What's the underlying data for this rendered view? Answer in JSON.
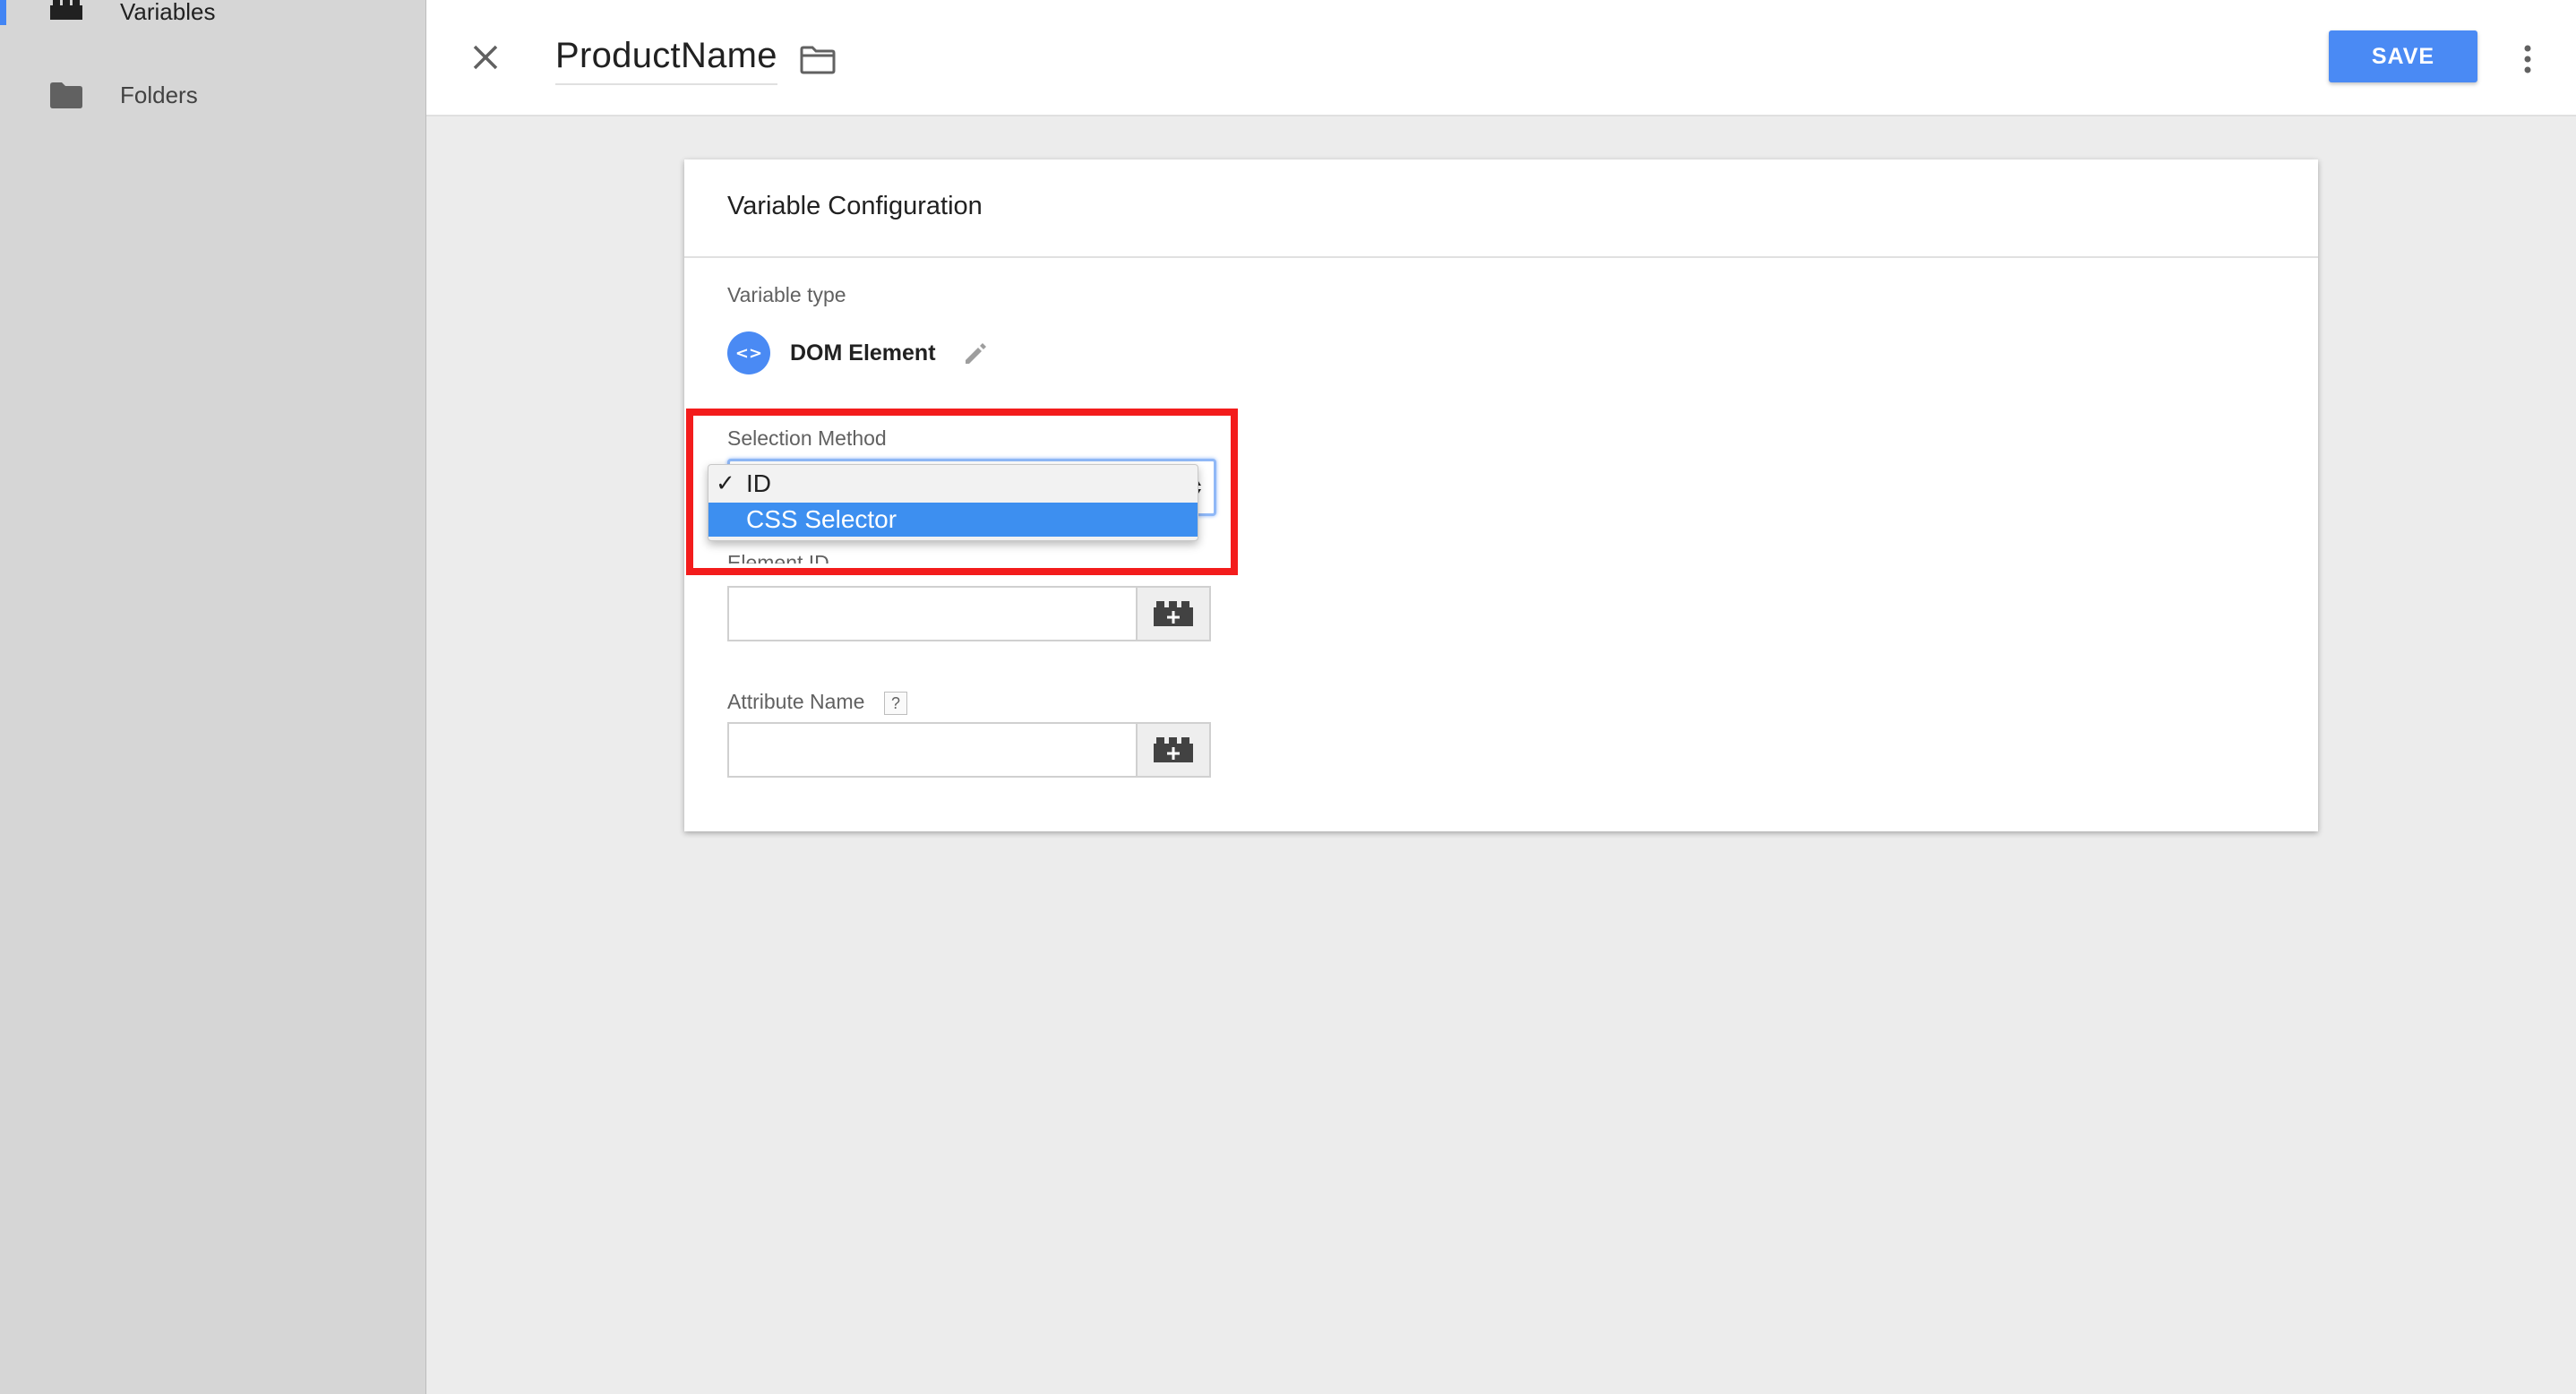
{
  "sidebar": {
    "items": [
      {
        "label": "Variables",
        "icon": "lego-block-icon",
        "active": true
      },
      {
        "label": "Folders",
        "icon": "folder-icon",
        "active": false
      }
    ],
    "accent_color": "#4285f4"
  },
  "header": {
    "title": "ProductName",
    "save_label": "SAVE"
  },
  "card": {
    "title": "Variable Configuration",
    "variable_type_label": "Variable type",
    "variable_type_value": "DOM Element",
    "variable_type_icon_glyph": "<>",
    "selection_method_label": "Selection Method",
    "selection_options": [
      {
        "label": "ID",
        "checked": true,
        "highlighted": false
      },
      {
        "label": "CSS Selector",
        "checked": false,
        "highlighted": true
      }
    ],
    "element_id_label": "Element ID",
    "element_id_value": "",
    "attribute_name_label": "Attribute Name",
    "attribute_name_value": "",
    "help_glyph": "?"
  },
  "annotation": {
    "highlight_color": "#f31c1c"
  },
  "colors": {
    "primary_button": "#4a8af4",
    "dropdown_highlight": "#3d8ff0"
  }
}
